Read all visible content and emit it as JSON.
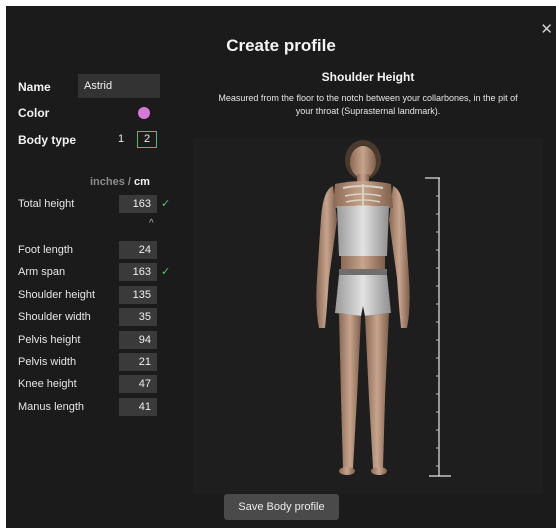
{
  "dialog": {
    "title": "Create profile",
    "close_glyph": "✕"
  },
  "form": {
    "name_label": "Name",
    "name_value": "Astrid",
    "color_label": "Color",
    "color_value": "#d77ad6",
    "body_type_label": "Body type",
    "body_type_options": [
      "1",
      "2"
    ],
    "body_type_selected": "2"
  },
  "units": {
    "inches": "inches",
    "separator": "/",
    "cm": "cm",
    "selected": "cm"
  },
  "measurements": {
    "total_height": {
      "label": "Total height",
      "value": "163",
      "checked": true
    },
    "collapse_glyph": "^",
    "rows": [
      {
        "label": "Foot length",
        "value": "24",
        "checked": false
      },
      {
        "label": "Arm span",
        "value": "163",
        "checked": true
      },
      {
        "label": "Shoulder height",
        "value": "135",
        "checked": false
      },
      {
        "label": "Shoulder width",
        "value": "35",
        "checked": false
      },
      {
        "label": "Pelvis height",
        "value": "94",
        "checked": false
      },
      {
        "label": "Pelvis width",
        "value": "21",
        "checked": false
      },
      {
        "label": "Knee height",
        "value": "47",
        "checked": false
      },
      {
        "label": "Manus length",
        "value": "41",
        "checked": false
      }
    ],
    "check_glyph": "✓"
  },
  "panel": {
    "title": "Shoulder Height",
    "description": "Measured from the floor to the notch between your collarbones, in the pit of your throat (Suprasternal landmark)."
  },
  "actions": {
    "save_label": "Save Body profile"
  },
  "colors": {
    "dialog_bg": "#1b1b1b",
    "accent_check": "#61c27c",
    "selected_border": "#5fb87a"
  }
}
